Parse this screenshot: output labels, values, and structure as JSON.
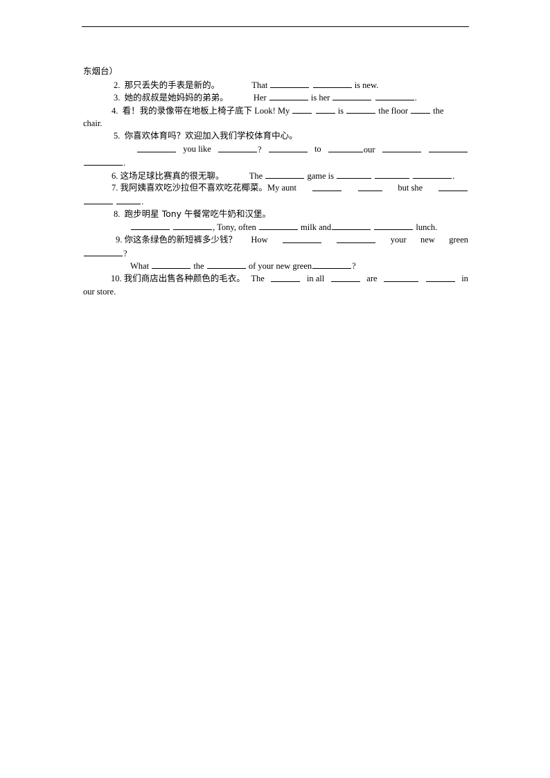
{
  "document": {
    "continuation_text": "东烟台）",
    "items": [
      {
        "num": "2.",
        "cn": "那只丢失的手表是新的。",
        "en": [
          "That",
          "is new."
        ]
      },
      {
        "num": "3.",
        "cn": "她的叔叔是她妈妈的弟弟。",
        "en": [
          "Her",
          "is her",
          "."
        ]
      },
      {
        "num": "4.",
        "cn": "看！我的录像带在地板上椅子底下",
        "en": [
          "Look! My",
          "is",
          "the floor",
          "the"
        ],
        "wrap": "chair."
      },
      {
        "num": "5.",
        "cn": "你喜欢体育吗？欢迎加入我们学校体育中心。",
        "en": [
          "you  like",
          "?",
          "to",
          "our"
        ],
        "wrap": "."
      },
      {
        "num": "6.",
        "cn": "这场足球比赛真的很无聊。",
        "en": [
          "The",
          "game is",
          "."
        ]
      },
      {
        "num": "7.",
        "cn": "我阿姨喜欢吃沙拉但不喜欢吃花椰菜。",
        "en": [
          "My  aunt",
          "but  she"
        ],
        "wrap": "."
      },
      {
        "num": "8.",
        "cn": "跑步明星 Tony 午餐常吃牛奶和汉堡。",
        "en": [
          ", Tony, often",
          "milk and",
          "lunch."
        ]
      },
      {
        "num": "9.",
        "cn": "你这条绿色的新短裤多少钱？",
        "en": [
          "How",
          "your",
          "new",
          "green"
        ],
        "wrap": "?",
        "alt": [
          "What",
          "the",
          "of your new green",
          "?"
        ]
      },
      {
        "num": "10.",
        "cn": "我们商店出售各种颜色的毛衣。",
        "en": [
          "The",
          "in all",
          "are",
          "in"
        ],
        "wrap": "our store."
      }
    ]
  }
}
